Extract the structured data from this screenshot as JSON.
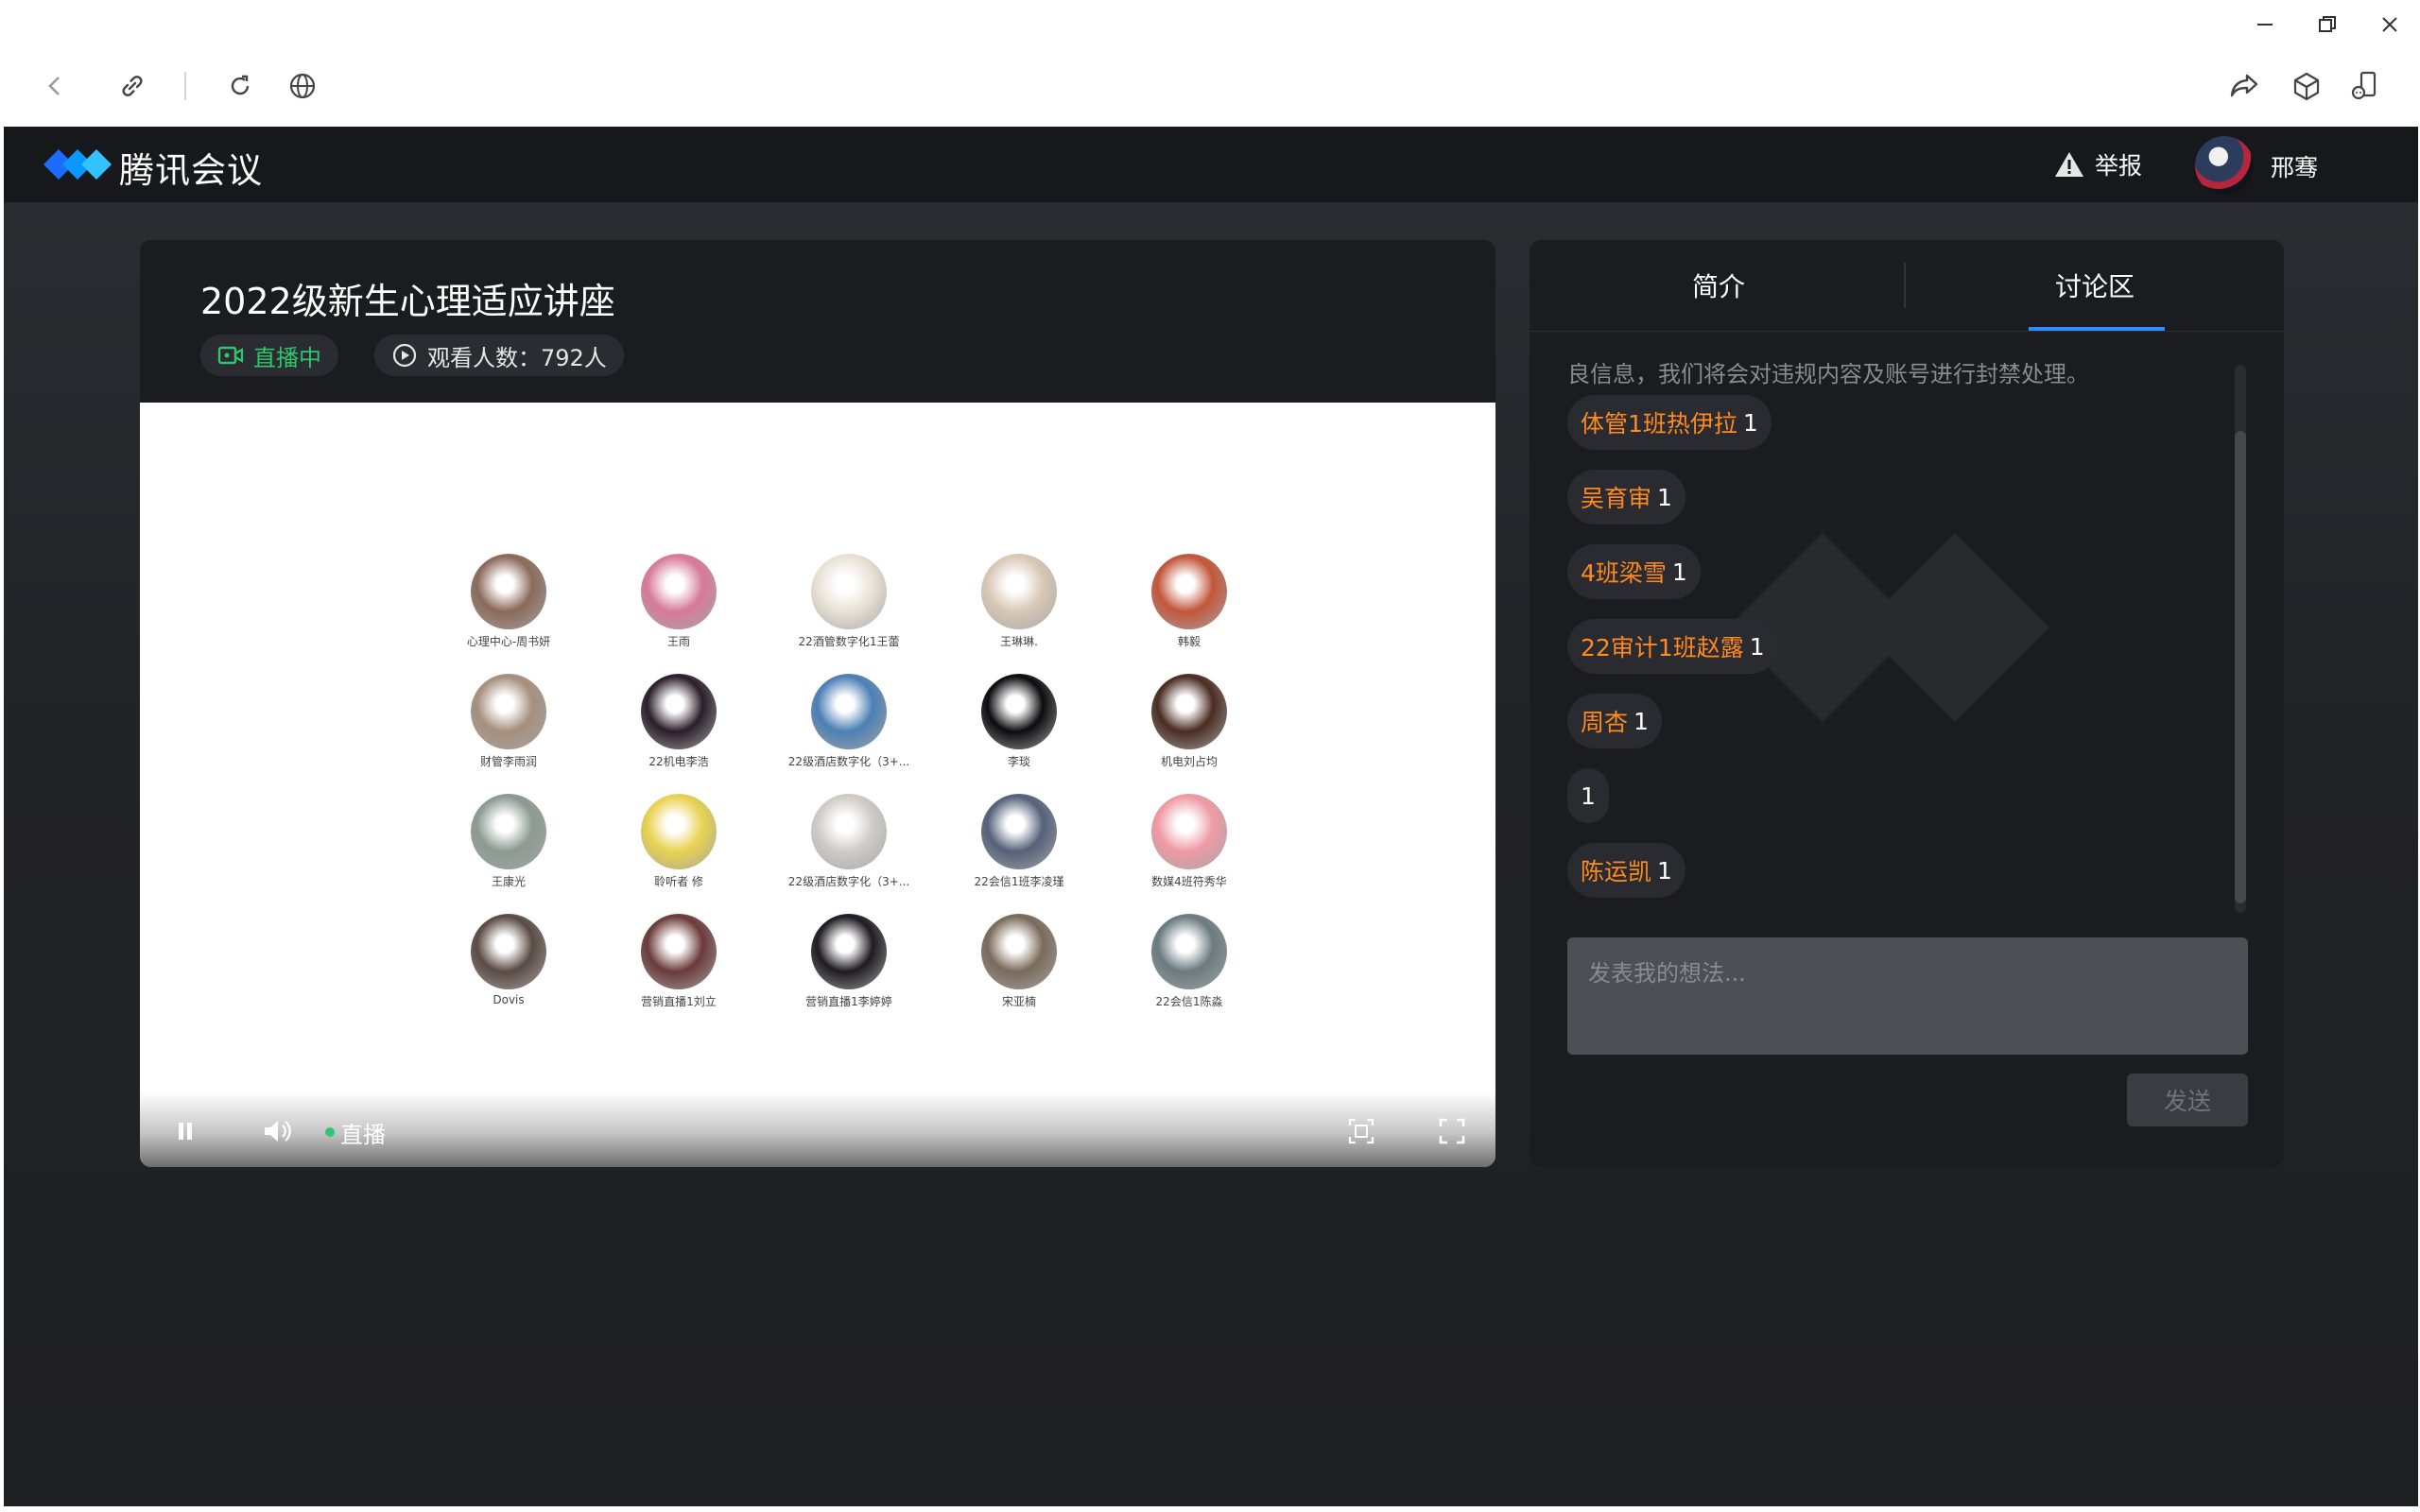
{
  "window": {
    "minimize_icon": "minimize-icon",
    "restore_icon": "restore-icon",
    "close_icon": "close-icon"
  },
  "toolbar": {
    "icons": [
      "back-icon",
      "link-icon",
      "refresh-icon",
      "globe-icon",
      "share-icon",
      "cube-icon",
      "phone-icon"
    ]
  },
  "app": {
    "brand": "腾讯会议",
    "report_label": "举报",
    "user_name": "邢骞",
    "accent": "#2d8cff",
    "live_color": "#2fc76e",
    "username_color": "#ff8a1f"
  },
  "video": {
    "title": "2022级新生心理适应讲座",
    "status": "直播中",
    "viewers_label": "观看人数：792人",
    "live_label": "直播",
    "participants": [
      {
        "name": "心理中心-周书妍",
        "color": "#8a6a5a"
      },
      {
        "name": "王雨",
        "color": "#d77a9a"
      },
      {
        "name": "22酒管数字化1王蕾",
        "color": "#e9e2d6"
      },
      {
        "name": "王琳琳.",
        "color": "#d9c8b6"
      },
      {
        "name": "韩毅",
        "color": "#c2563a"
      },
      {
        "name": "财管李雨润",
        "color": "#a68f7d"
      },
      {
        "name": "22机电李浩",
        "color": "#2b1e2a"
      },
      {
        "name": "22级酒店数字化（3+...",
        "color": "#4c7fb5"
      },
      {
        "name": "李琰",
        "color": "#0c0c10"
      },
      {
        "name": "机电刘占均",
        "color": "#4a2c22"
      },
      {
        "name": "王康光",
        "color": "#8c9a90"
      },
      {
        "name": "聆听者 修",
        "color": "#e8d250"
      },
      {
        "name": "22级酒店数字化（3+...",
        "color": "#d0cbc7"
      },
      {
        "name": "22会信1班李凌瑾",
        "color": "#55617a"
      },
      {
        "name": "数媒4班符秀华",
        "color": "#ef9aa5"
      },
      {
        "name": "Dovis",
        "color": "#5a4a44"
      },
      {
        "name": "营销直播1刘立",
        "color": "#6b3a3a"
      },
      {
        "name": "营销直播1李婷婷",
        "color": "#1e1b22"
      },
      {
        "name": "宋亚楠",
        "color": "#7a6a5a"
      },
      {
        "name": "22会信1陈淼",
        "color": "#6a7a7f"
      }
    ]
  },
  "side": {
    "tab_intro": "简介",
    "tab_discussion": "讨论区",
    "truncated_text": "良信息，我们将会对违规内容及账号进行封禁处理。",
    "messages": [
      {
        "user": "体管1班热伊拉",
        "text": "1"
      },
      {
        "user": "吴育审",
        "text": "1"
      },
      {
        "user": "4班梁雪",
        "text": "1"
      },
      {
        "user": "22审计1班赵露",
        "text": "1"
      },
      {
        "user": "周杏",
        "text": "1"
      },
      {
        "user": "",
        "text": "1"
      },
      {
        "user": "陈运凯",
        "text": "1"
      }
    ],
    "input_placeholder": "发表我的想法...",
    "send_label": "发送"
  }
}
